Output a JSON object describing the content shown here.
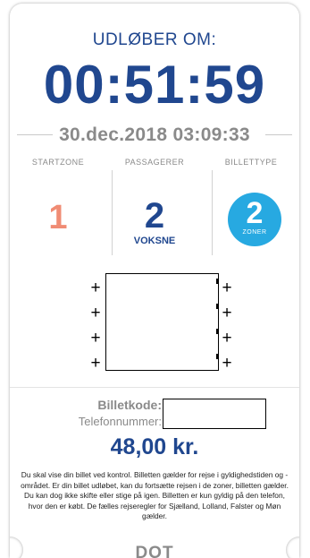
{
  "ticket": {
    "expires_label": "UDLØBER OM:",
    "countdown": "00:51:59",
    "expiry_datetime": "30.dec.2018 03:09:33"
  },
  "columns": {
    "startzone": {
      "title": "STARTZONE",
      "value": "1"
    },
    "passengers": {
      "title": "PASSAGERER",
      "value": "2",
      "type": "VOKSNE"
    },
    "ticket_type": {
      "title": "BILLETTYPE",
      "value": "2",
      "unit": "ZONER"
    }
  },
  "plus_glyph": "+",
  "codes": {
    "ticket_code_label": "Billetkode:",
    "phone_label": "Telefonnummer:"
  },
  "price": "48,00 kr.",
  "info_text": "Du skal vise din billet ved kontrol. Billetten gælder for rejse i gyldighedstiden og -området. Er din billet udløbet, kan du fortsætte rejsen i de zoner, billetten gælder. Du kan dog ikke skifte eller stige på igen. Billetten er kun gyldig på den telefon, hvor den er købt. De fælles rejseregler for Sjælland, Lolland, Falster og Møn gælder.",
  "logo_text": "DOT",
  "colors": {
    "primary_blue": "#20478f",
    "startzone_salmon": "#f08c74",
    "zone_badge_blue": "#27a9e1",
    "muted_gray": "#8a8a8a"
  }
}
